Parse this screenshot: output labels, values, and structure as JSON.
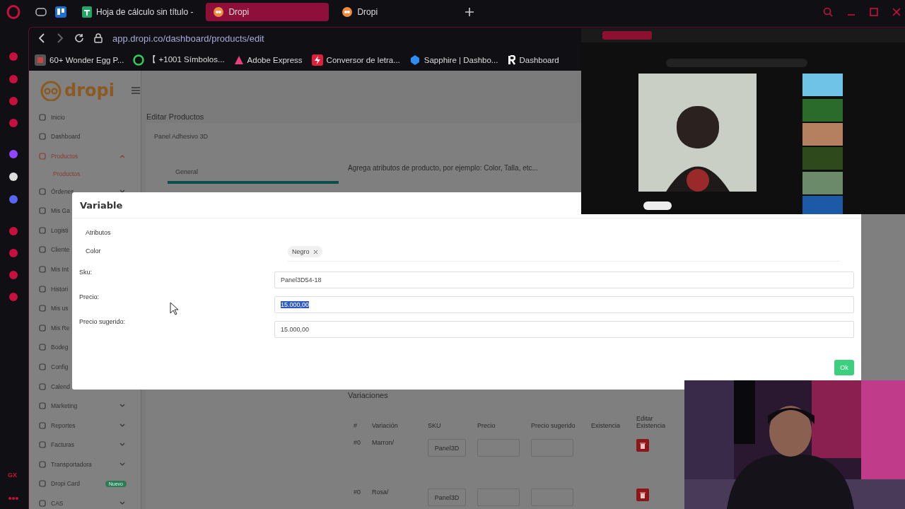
{
  "browser": {
    "tabs": [
      {
        "label": "Hoja de cálculo sin título -",
        "selected": false,
        "kind": "sheet"
      },
      {
        "label": "Dropi",
        "selected": true,
        "kind": "dropi"
      },
      {
        "label": "Dropi",
        "selected": false,
        "kind": "dropi"
      }
    ],
    "address": "app.dropi.co/dashboard/products/edit",
    "panel_label": "GX",
    "bookmarks": [
      {
        "label": "60+ Wonder Egg P...",
        "kind": "game"
      },
      {
        "label": "【 +1001 Símbolos...",
        "kind": "symbol"
      },
      {
        "label": "Adobe Express",
        "kind": "adobe"
      },
      {
        "label": "Conversor de letra...",
        "kind": "bolt"
      },
      {
        "label": "Sapphire | Dashbo...",
        "kind": "gem"
      },
      {
        "label": "Dashboard",
        "kind": "letter"
      }
    ]
  },
  "sidebar": {
    "logo": "dropi",
    "items": [
      {
        "label": "Inicio",
        "selected": false,
        "expandable": false
      },
      {
        "label": "Dashboard",
        "selected": false,
        "expandable": false
      },
      {
        "label": "Productos",
        "selected": true,
        "expandable": true,
        "expanded": true,
        "children": [
          {
            "label": "Productos",
            "selected": true
          }
        ]
      },
      {
        "label": "Órdenes",
        "selected": false,
        "expandable": true,
        "expanded": false
      },
      {
        "label": "Mis Ga",
        "selected": false,
        "expandable": false
      },
      {
        "label": "Logisti",
        "selected": false,
        "expandable": false
      },
      {
        "label": "Cliente",
        "selected": false,
        "expandable": false
      },
      {
        "label": "Mis Int",
        "selected": false,
        "expandable": false
      },
      {
        "label": "Histori",
        "selected": false,
        "expandable": false
      },
      {
        "label": "Mis us",
        "selected": false,
        "expandable": false
      },
      {
        "label": "Mis Re",
        "selected": false,
        "expandable": false
      },
      {
        "label": "Bodeg",
        "selected": false,
        "expandable": false
      },
      {
        "label": "Config",
        "selected": false,
        "expandable": false
      },
      {
        "label": "Calend",
        "selected": false,
        "expandable": false
      },
      {
        "label": "Marketing",
        "selected": false,
        "expandable": true,
        "expanded": false
      },
      {
        "label": "Reportes",
        "selected": false,
        "expandable": true,
        "expanded": false
      },
      {
        "label": "Facturas",
        "selected": false,
        "expandable": true,
        "expanded": false
      },
      {
        "label": "Transportadora",
        "selected": false,
        "expandable": true,
        "expanded": false
      },
      {
        "label": "Dropi Card",
        "selected": false,
        "expandable": false,
        "badge": "Nuevo"
      },
      {
        "label": "CAS",
        "selected": false,
        "expandable": true,
        "expanded": false
      }
    ]
  },
  "page": {
    "title": "Editar Productos",
    "product_name": "Panel Adhesivo 3D",
    "tabs": [
      {
        "label": "General",
        "selected": true
      }
    ],
    "hint": "Agrega atributos de producto, por ejemplo: Color, Talla, etc...",
    "variations": {
      "title": "Variaciones",
      "columns": [
        "#",
        "Variación",
        "SKU",
        "Precio",
        "Precio sugerido",
        "Existencia",
        "Editar Existencia"
      ],
      "rows": [
        {
          "index": "#0",
          "variation": "Marron/",
          "sku": "Panel3D"
        },
        {
          "index": "#0",
          "variation": "Rosa/",
          "sku": "Panel3D"
        }
      ]
    }
  },
  "modal": {
    "title": "Variable",
    "attributes_label": "Atributos",
    "attribute_name": "Color",
    "values": [
      "Negro"
    ],
    "fields": [
      {
        "label": "Sku:",
        "value": "Panel3D54-18",
        "selected": false
      },
      {
        "label": "Precio:",
        "value": "15.000,00",
        "selected": true
      },
      {
        "label": "Precio sugerido:",
        "value": "15.000,00",
        "selected": false
      }
    ],
    "ok": "Ok"
  }
}
